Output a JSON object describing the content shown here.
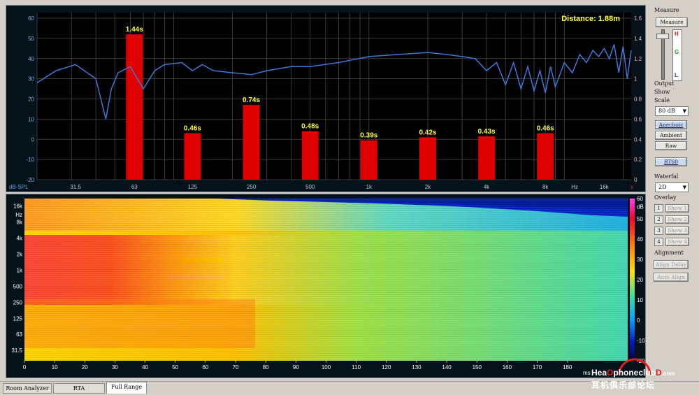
{
  "rt60_plot": {
    "distance_label": "Distance: 1.88m",
    "left_axis_unit": "dB-SPL",
    "left_ticks": [
      "60",
      "50",
      "40",
      "30",
      "20",
      "10",
      "0",
      "-10",
      "-20"
    ],
    "right_ticks": [
      "1.6",
      "1.4",
      "1.2",
      "1",
      "0.8",
      "0.6",
      "0.4",
      "0.2",
      "0"
    ],
    "right_axis_unit": "s",
    "freq_ticks": [
      "31.5",
      "63",
      "125",
      "250",
      "500",
      "1k",
      "2k",
      "4k",
      "8k",
      "Hz",
      "16k"
    ],
    "bar_color": "#e00000",
    "curve_color": "#3c78d8",
    "label_color": "#ffff33"
  },
  "chart_data": [
    {
      "type": "bar",
      "title": "",
      "categories": [
        "63",
        "125",
        "250",
        "500",
        "1k",
        "2k",
        "4k",
        "8k"
      ],
      "values": [
        1.44,
        0.46,
        0.74,
        0.48,
        0.39,
        0.42,
        0.43,
        0.46
      ],
      "value_labels": [
        "1.44s",
        "0.46s",
        "0.74s",
        "0.48s",
        "0.39s",
        "0.42s",
        "0.43s",
        "0.46s"
      ],
      "xlabel": "Hz",
      "ylabel": "s",
      "ylim": [
        0,
        1.6
      ],
      "grid": true
    },
    {
      "type": "line",
      "series": [
        {
          "x": [
            20,
            25,
            31.5,
            40,
            45,
            48,
            52,
            60,
            70,
            80,
            90,
            110,
            125,
            140,
            160,
            200,
            250,
            300,
            400,
            500,
            700,
            1000,
            1400,
            2000,
            2500,
            3000,
            3500,
            4000,
            4500,
            5000,
            5500,
            6000,
            6500,
            7000,
            7500,
            8000,
            8500,
            9000,
            10000,
            11000,
            12000,
            13000,
            14000,
            15000,
            16000,
            17000,
            18000,
            19000,
            20000,
            21000,
            22000
          ],
          "y": [
            28,
            34,
            37,
            30,
            10,
            25,
            33,
            36,
            25,
            34,
            37,
            38,
            34,
            37,
            34,
            33,
            32,
            34,
            36,
            36,
            38,
            41,
            42,
            43,
            42,
            41,
            40,
            34,
            38,
            27,
            38,
            25,
            36,
            24,
            34,
            23,
            36,
            26,
            38,
            33,
            42,
            38,
            44,
            41,
            45,
            40,
            47,
            33,
            46,
            30,
            44
          ]
        }
      ],
      "xlabel": "Hz",
      "ylabel": "dB-SPL",
      "ylim": [
        -20,
        60
      ],
      "grid": true
    }
  ],
  "waterfall_plot": {
    "freq_ticks": [
      "16k",
      "Hz",
      "8k",
      "4k",
      "2k",
      "1k",
      "500",
      "250",
      "125",
      "63",
      "31.5"
    ],
    "time_ticks": [
      "0",
      "10",
      "20",
      "30",
      "40",
      "50",
      "60",
      "70",
      "80",
      "90",
      "100",
      "110",
      "120",
      "130",
      "140",
      "150",
      "160",
      "170",
      "180"
    ],
    "time_unit": "ms",
    "colorbar_ticks": [
      "60",
      "dB",
      "50",
      "40",
      "30",
      "20",
      "10",
      "0",
      "-10",
      "-20"
    ]
  },
  "side_panel": {
    "measure_label": "Measure",
    "measure_button": "Measure",
    "meter_letters": [
      "H",
      "G",
      "L"
    ],
    "output_label": "Output",
    "show_label": "Show",
    "scale_label": "Scale",
    "scale_value": "80 dB",
    "anechoic_button": "Anechoic",
    "ambient_button": "Ambient",
    "raw_button": "Raw",
    "rt60_button": "RT60",
    "waterfall_label": "Waterfal",
    "waterfall_value": "2D",
    "overlay_label": "Overlay",
    "overlay_items": [
      {
        "num": "1",
        "label": "Show 1"
      },
      {
        "num": "2",
        "label": "Show 2"
      },
      {
        "num": "3",
        "label": "Show 3"
      },
      {
        "num": "4",
        "label": "Show 4"
      }
    ],
    "alignment_label": "Alignment",
    "align_delay_button": "Align Delay",
    "auto_align_button": "Auto Align"
  },
  "tabs": [
    "Room Analyzer",
    "RTA",
    "Full Range"
  ],
  "watermark": {
    "line1_a": "Hea",
    "line1_b": "phone",
    "line1_c": "club",
    "line1_d": ".com",
    "line2": "耳机俱乐部论坛"
  }
}
